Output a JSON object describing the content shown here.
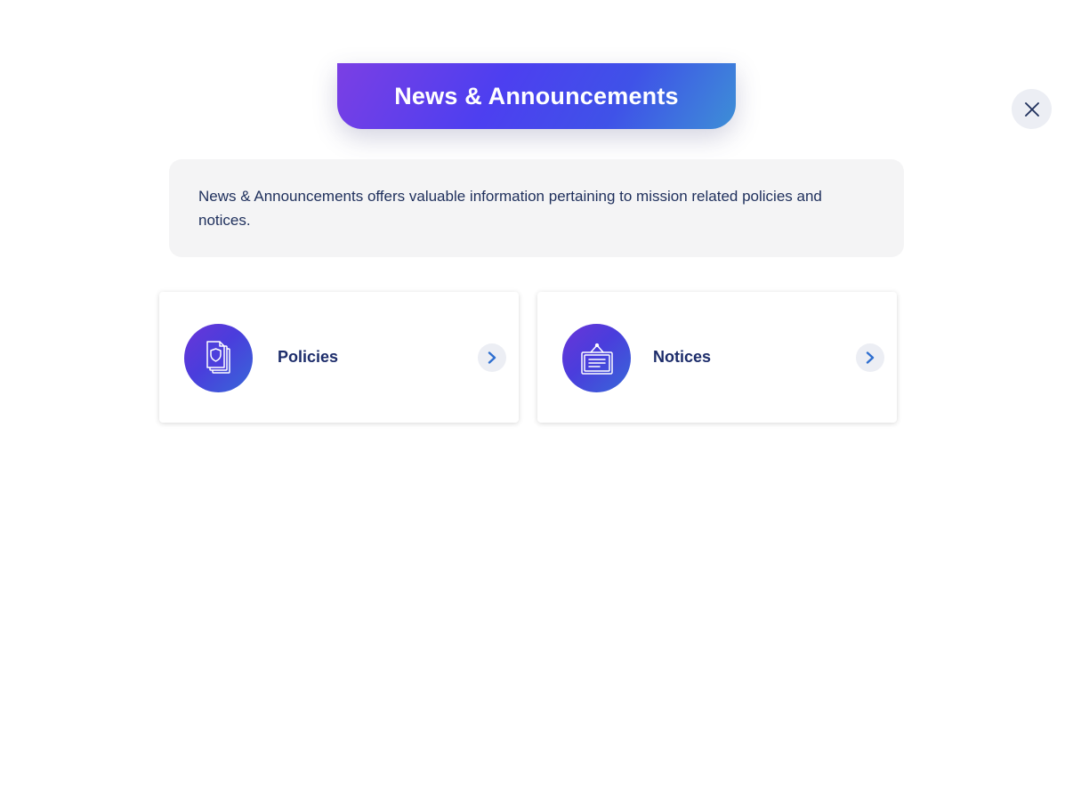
{
  "header": {
    "title": "News & Announcements"
  },
  "close": {
    "icon": "close-icon"
  },
  "description": {
    "text": "News & Announcements offers valuable information pertaining to mission related policies and notices."
  },
  "cards": [
    {
      "label": "Policies",
      "icon": "shield-documents-icon"
    },
    {
      "label": "Notices",
      "icon": "notice-board-icon"
    }
  ],
  "colors": {
    "title_gradient_start": "#7b3fe4",
    "title_gradient_end": "#3d8fd6",
    "text_navy": "#1d2d6b",
    "chevron_blue": "#2f6fd0"
  }
}
